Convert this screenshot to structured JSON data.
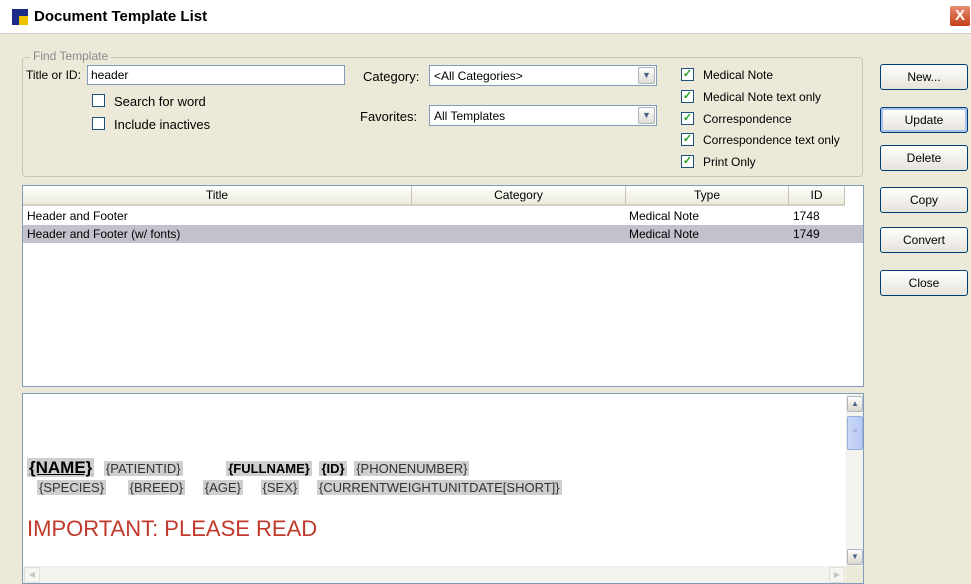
{
  "window": {
    "title": "Document Template List",
    "close_label": "X"
  },
  "find": {
    "legend": "Find Template",
    "title_label": "Title or ID:",
    "title_value": "header",
    "search_for_word": {
      "label": "Search for word",
      "checked": false
    },
    "include_inactives": {
      "label": "Include inactives",
      "checked": false
    },
    "category_label": "Category:",
    "category_value": "<All Categories>",
    "favorites_label": "Favorites:",
    "favorites_value": "All Templates",
    "types": [
      {
        "label": "Medical Note",
        "checked": true
      },
      {
        "label": "Medical Note text only",
        "checked": true
      },
      {
        "label": "Correspondence",
        "checked": true
      },
      {
        "label": "Correspondence text only",
        "checked": true
      },
      {
        "label": "Print Only",
        "checked": true
      }
    ]
  },
  "buttons": {
    "new": "New...",
    "update": "Update",
    "delete": "Delete",
    "copy": "Copy",
    "convert": "Convert",
    "close": "Close"
  },
  "list": {
    "columns": [
      "Title",
      "Category",
      "Type",
      "ID"
    ],
    "rows": [
      {
        "title": "Header and Footer",
        "category": "",
        "type": "Medical Note",
        "id": "1748",
        "selected": false
      },
      {
        "title": "Header and Footer (w/ fonts)",
        "category": "",
        "type": "Medical Note",
        "id": "1749",
        "selected": true
      }
    ]
  },
  "preview": {
    "line1": [
      "{NAME}",
      "{PATIENTID}",
      "{FULLNAME}",
      "{ID}",
      "{PHONENUMBER}"
    ],
    "line2": [
      "{SPECIES}",
      "{BREED}",
      "{AGE}",
      "{SEX}",
      "{CURRENTWEIGHTUNITDATE[SHORT]}"
    ],
    "important": "IMPORTANT: PLEASE READ"
  },
  "colors": {
    "window_bg": "#ece9d8",
    "selection": "#c2c2cc",
    "important_text": "#c0392b",
    "button_border": "#003c74"
  }
}
